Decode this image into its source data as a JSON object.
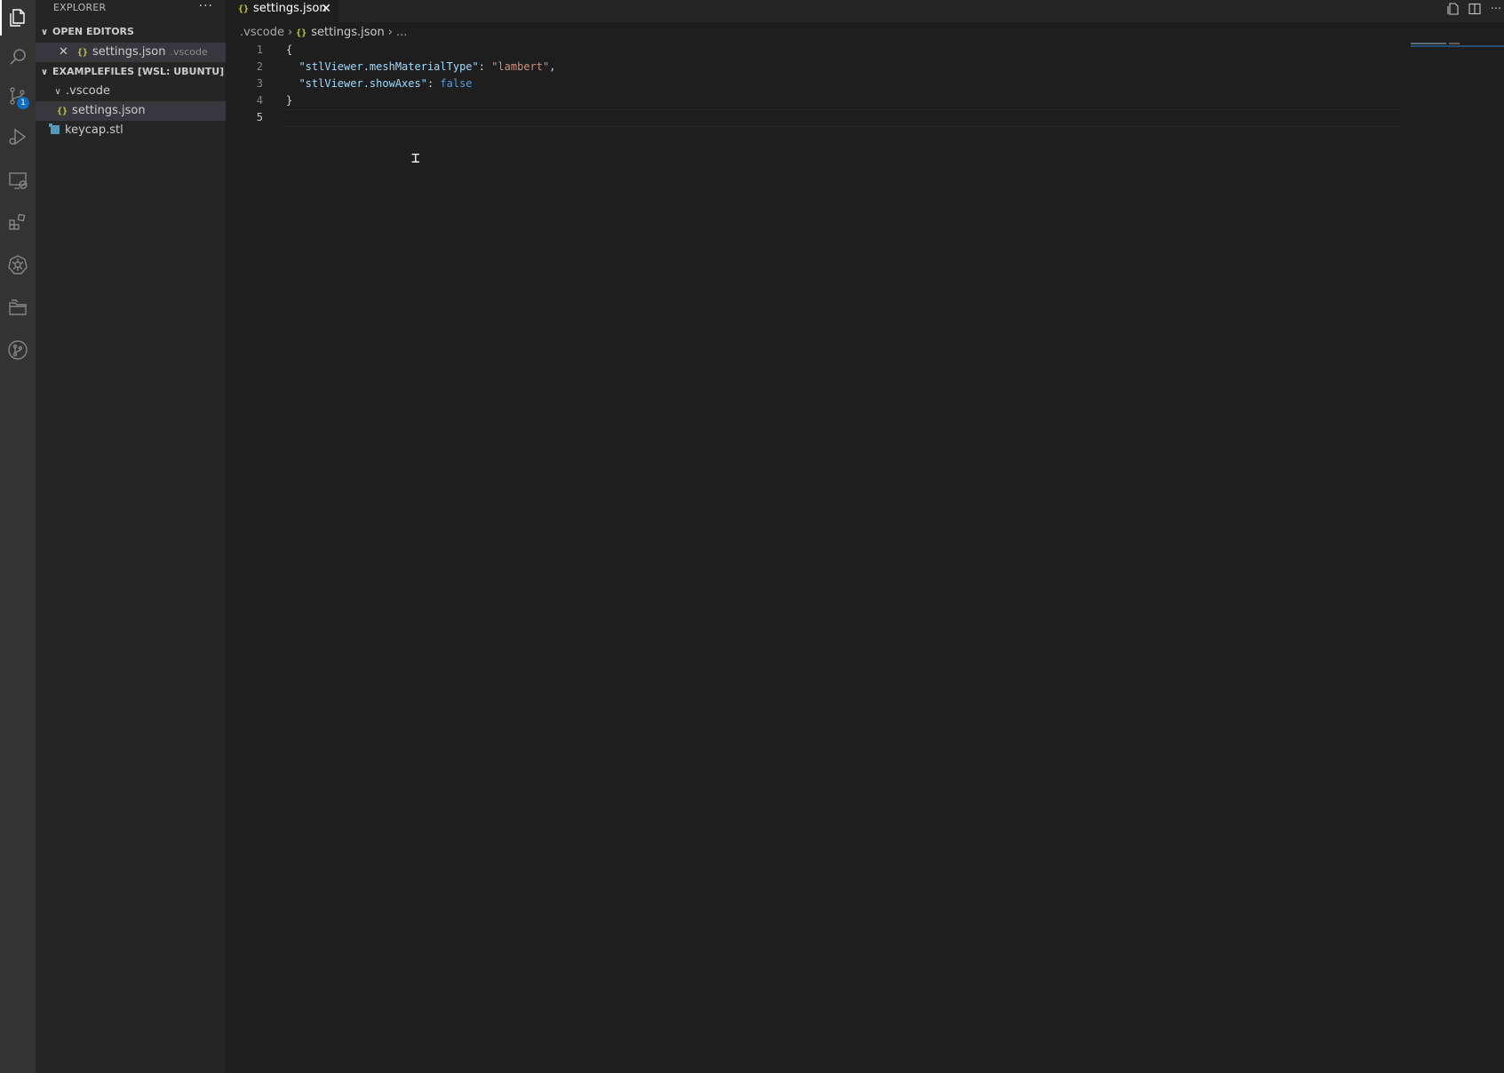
{
  "activity_bar": {
    "items": [
      {
        "icon": "files-icon",
        "active": true
      },
      {
        "icon": "search-icon"
      },
      {
        "icon": "source-control-icon",
        "badge": "1"
      },
      {
        "icon": "run-debug-icon"
      },
      {
        "icon": "remote-explorer-icon"
      },
      {
        "icon": "extensions-icon"
      },
      {
        "icon": "kubernetes-icon"
      },
      {
        "icon": "folders-icon"
      },
      {
        "icon": "git-graph-icon"
      }
    ]
  },
  "sidebar": {
    "title": "EXPLORER",
    "more": "···",
    "open_editors": {
      "header": "OPEN EDITORS",
      "items": [
        {
          "icon_text": "{}",
          "name": "settings.json",
          "desc": ".vscode"
        }
      ]
    },
    "workspace": {
      "header": "EXAMPLEFILES [WSL: UBUNTU]",
      "folder": ".vscode",
      "folder_files": [
        {
          "icon_text": "{}",
          "name": "settings.json"
        }
      ],
      "root_files": [
        {
          "name": "keycap.stl"
        }
      ]
    }
  },
  "tabs": [
    {
      "icon_text": "{}",
      "label": "settings.json",
      "active": true
    }
  ],
  "tab_actions": [
    "open-changes-icon",
    "split-editor-icon",
    "more-actions-icon"
  ],
  "breadcrumb": {
    "folder": ".vscode",
    "file_icon": "{}",
    "file": "settings.json",
    "tail": "..."
  },
  "editor": {
    "line_numbers": [
      "1",
      "2",
      "3",
      "4",
      "5"
    ],
    "active_line": "5",
    "lines": [
      {
        "tokens": [
          {
            "t": "punc",
            "v": "{"
          }
        ]
      },
      {
        "tokens": [
          {
            "t": "punc",
            "v": "  "
          },
          {
            "t": "key",
            "v": "\"stlViewer.meshMaterialType\""
          },
          {
            "t": "punc",
            "v": ": "
          },
          {
            "t": "str",
            "v": "\"lambert\""
          },
          {
            "t": "punc",
            "v": ","
          }
        ]
      },
      {
        "tokens": [
          {
            "t": "punc",
            "v": "  "
          },
          {
            "t": "key",
            "v": "\"stlViewer.showAxes\""
          },
          {
            "t": "punc",
            "v": ": "
          },
          {
            "t": "kw",
            "v": "false"
          }
        ]
      },
      {
        "tokens": [
          {
            "t": "punc",
            "v": "}"
          }
        ]
      },
      {
        "tokens": []
      }
    ]
  },
  "colors": {
    "activity_bar": "#333333",
    "sidebar": "#252526",
    "editor": "#1e1e1e",
    "json_icon": "#cbcb41",
    "stl_icon": "#519aba",
    "badge": "#0e70c0"
  }
}
